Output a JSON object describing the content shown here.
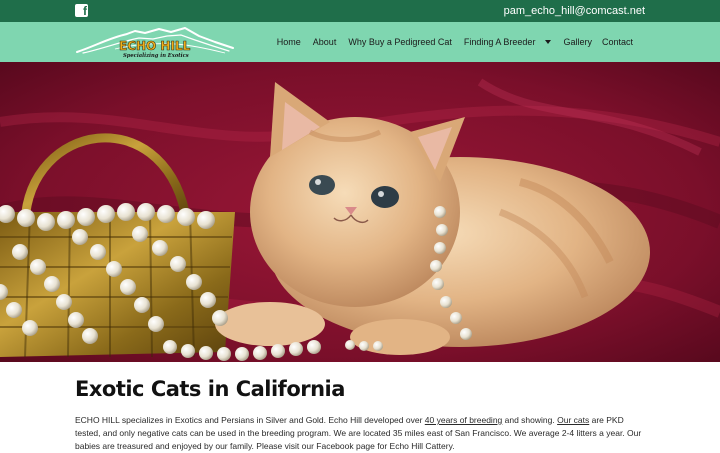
{
  "topbar": {
    "facebook_icon": "facebook-icon",
    "email": "pam_echo_hill@comcast.net"
  },
  "colors": {
    "topbar_bg": "#1f6e4a",
    "nav_bg": "#7fd6b0",
    "hero_bg": "#7a0f2a"
  },
  "logo": {
    "name": "ECHO HILL",
    "tagline": "Specializing in Exotics"
  },
  "nav": {
    "items": [
      "Home",
      "About",
      "Why Buy a Pedigreed Cat",
      "Finding A Breeder",
      "Gallery",
      "Contact"
    ],
    "dropdown_icon": "caret-down-icon"
  },
  "hero": {
    "subject": "cream exotic kitten beside gold basket with pearls"
  },
  "main": {
    "title": "Exotic Cats in California",
    "intro_part1": "ECHO HILL specializes in Exotics and Persians in Silver and Gold. Echo Hill developed over ",
    "link1": "40 years of breeding",
    "intro_part2": " and showing. ",
    "link2": "Our cats",
    "intro_part3": " are PKD tested, and only negative cats can be used in the breeding program. We are located 35 miles east of San Francisco. We average 2-4 litters a year. Our babies are treasured and enjoyed by our family. Please visit our Facebook page for Echo Hill Cattery."
  }
}
